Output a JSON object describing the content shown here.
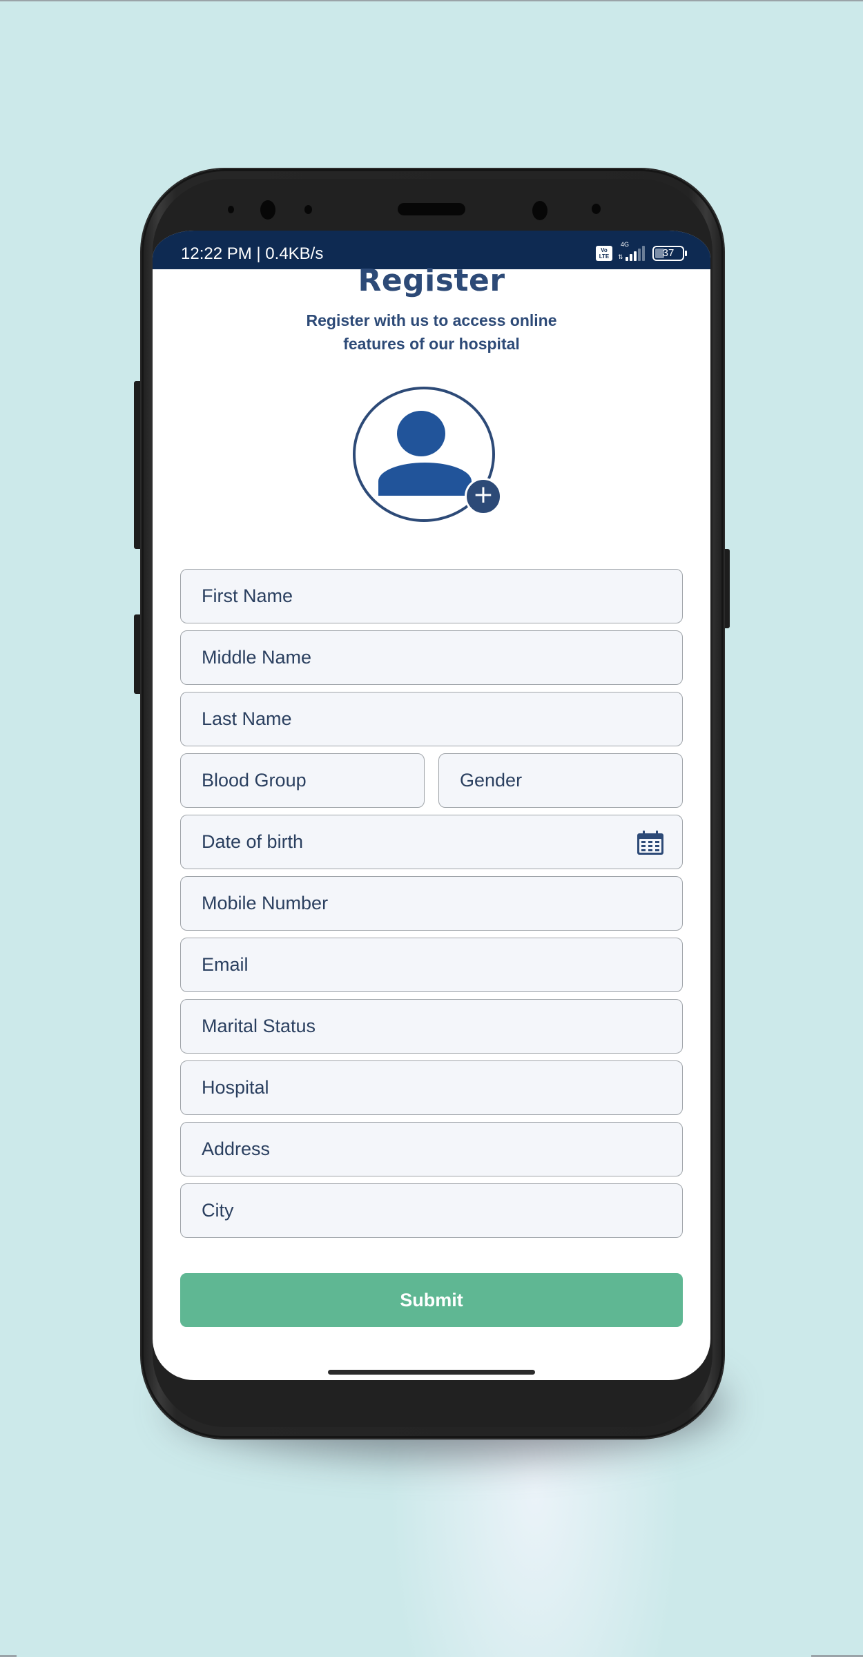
{
  "status_bar": {
    "time_speed": "12:22 PM | 0.4KB/s",
    "volte_label": "Vo LTE",
    "network_type": "4G",
    "battery_level": "37"
  },
  "header": {
    "title": "Register",
    "subtitle_line1": "Register with us to access online",
    "subtitle_line2": "features of our hospital"
  },
  "avatar": {
    "icon": "user-silhouette-icon",
    "add_icon": "plus-icon",
    "add_glyph": "+"
  },
  "form": {
    "first_name": {
      "placeholder": "First Name",
      "value": ""
    },
    "middle_name": {
      "placeholder": "Middle Name",
      "value": ""
    },
    "last_name": {
      "placeholder": "Last Name",
      "value": ""
    },
    "blood_group": {
      "placeholder": "Blood Group",
      "value": ""
    },
    "gender": {
      "placeholder": "Gender",
      "value": ""
    },
    "date_of_birth": {
      "placeholder": "Date of birth",
      "value": "",
      "icon": "calendar-icon"
    },
    "mobile_number": {
      "placeholder": "Mobile Number",
      "value": ""
    },
    "email": {
      "placeholder": "Email",
      "value": ""
    },
    "marital_status": {
      "placeholder": "Marital Status",
      "value": ""
    },
    "hospital": {
      "placeholder": "Hospital",
      "value": ""
    },
    "address": {
      "placeholder": "Address",
      "value": ""
    },
    "city": {
      "placeholder": "City",
      "value": ""
    },
    "submit_label": "Submit"
  },
  "colors": {
    "primary": "#2d4a77",
    "status_bar": "#0e2a52",
    "submit": "#5fb793",
    "field_bg": "#f4f6fa",
    "background": "#cce9ea"
  }
}
